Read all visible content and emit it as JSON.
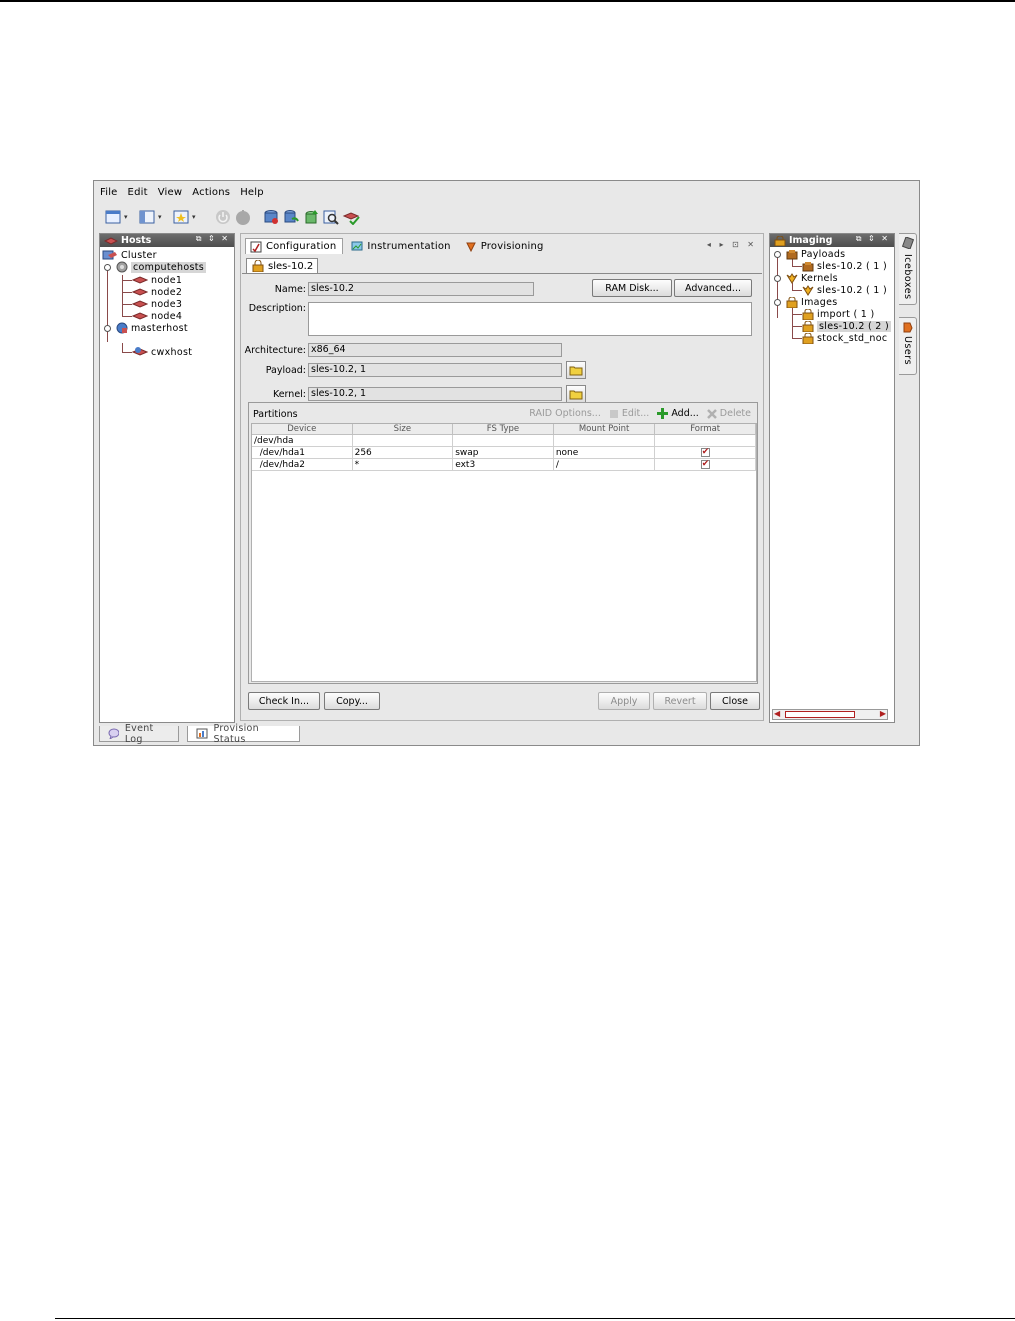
{
  "menu": [
    "File",
    "Edit",
    "View",
    "Actions",
    "Help"
  ],
  "hosts_panel": {
    "title": "Hosts",
    "tree": {
      "root": "Cluster",
      "group": "computehosts",
      "nodes": [
        "node1",
        "node2",
        "node3",
        "node4"
      ],
      "master": "masterhost",
      "master_child": "cwxhost"
    }
  },
  "center": {
    "tabs": [
      "Configuration",
      "Instrumentation",
      "Provisioning"
    ],
    "doc_tab": "sles-10.2",
    "form": {
      "name_label": "Name:",
      "name_value": "sles-10.2",
      "ramdisk_button": "RAM Disk...",
      "advanced_button": "Advanced...",
      "description_label": "Description:",
      "description_value": "",
      "architecture_label": "Architecture:",
      "architecture_value": "x86_64",
      "payload_label": "Payload:",
      "payload_value": "sles-10.2, 1",
      "kernel_label": "Kernel:",
      "kernel_value": "sles-10.2, 1"
    },
    "partitions": {
      "title": "Partitions",
      "raid_options": "RAID Options...",
      "edit": "Edit...",
      "add": "Add...",
      "delete": "Delete",
      "columns": [
        "Device",
        "Size",
        "FS Type",
        "Mount Point",
        "Format"
      ],
      "rows": [
        {
          "device": "/dev/hda",
          "size": "",
          "fstype": "",
          "mount": "",
          "format": false
        },
        {
          "device": "  /dev/hda1",
          "size": "256",
          "fstype": "swap",
          "mount": "none",
          "format": true
        },
        {
          "device": "  /dev/hda2",
          "size": "*",
          "fstype": "ext3",
          "mount": "/",
          "format": true
        }
      ]
    },
    "buttons": {
      "check_in": "Check In...",
      "copy": "Copy...",
      "apply": "Apply",
      "revert": "Revert",
      "close": "Close"
    }
  },
  "imaging_panel": {
    "title": "Imaging",
    "payloads": "Payloads",
    "payload_item": "sles-10.2 ( 1 )",
    "kernels": "Kernels",
    "kernel_item": "sles-10.2 ( 1 )",
    "images": "Images",
    "image_items": [
      "import ( 1 )",
      "sles-10.2 ( 2 )",
      "stock_std_noc"
    ]
  },
  "side_tabs": [
    "Iceboxes",
    "Users"
  ],
  "status_tabs": [
    "Event Log",
    "Provision Status"
  ]
}
